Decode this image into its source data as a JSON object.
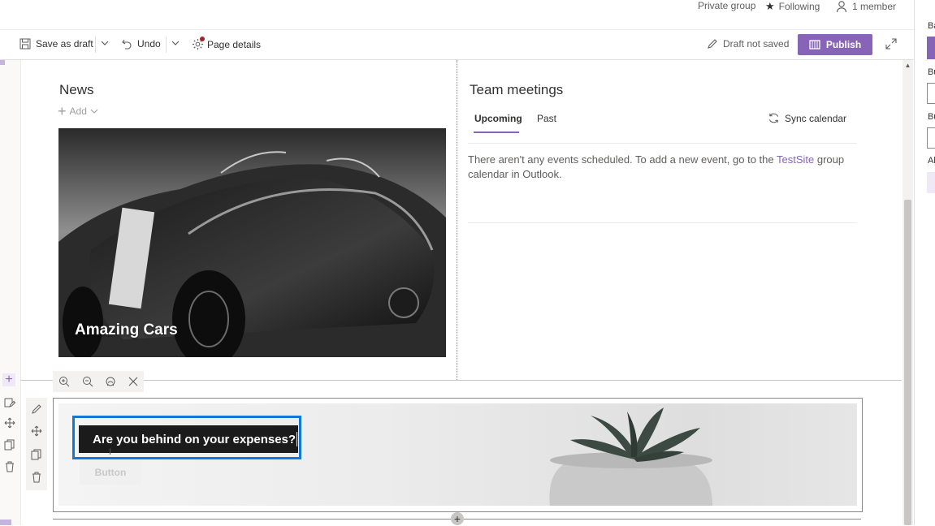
{
  "group_bar": {
    "privacy": "Private group",
    "following": "Following",
    "members": "1 member"
  },
  "command_bar": {
    "save_draft": "Save as draft",
    "undo": "Undo",
    "page_details": "Page details",
    "status": "Draft not saved",
    "publish": "Publish"
  },
  "news": {
    "title": "News",
    "add": "Add",
    "headline": "Amazing Cars"
  },
  "meetings": {
    "title": "Team meetings",
    "tabs": [
      "Upcoming",
      "Past"
    ],
    "sync": "Sync calendar",
    "empty_text_before": "There aren't any events scheduled. To add a new event, go to the ",
    "site_link": "TestSite",
    "empty_text_after": " group calendar in Outlook."
  },
  "banner": {
    "heading": "Are you behind on your expenses?",
    "button": "Button"
  },
  "right_panel": {
    "labels": [
      "Ba",
      "Bu",
      "Bu",
      "Al"
    ]
  },
  "colors": {
    "accent": "#8764b8",
    "focus": "#1177d8",
    "link": "#8764b8"
  }
}
